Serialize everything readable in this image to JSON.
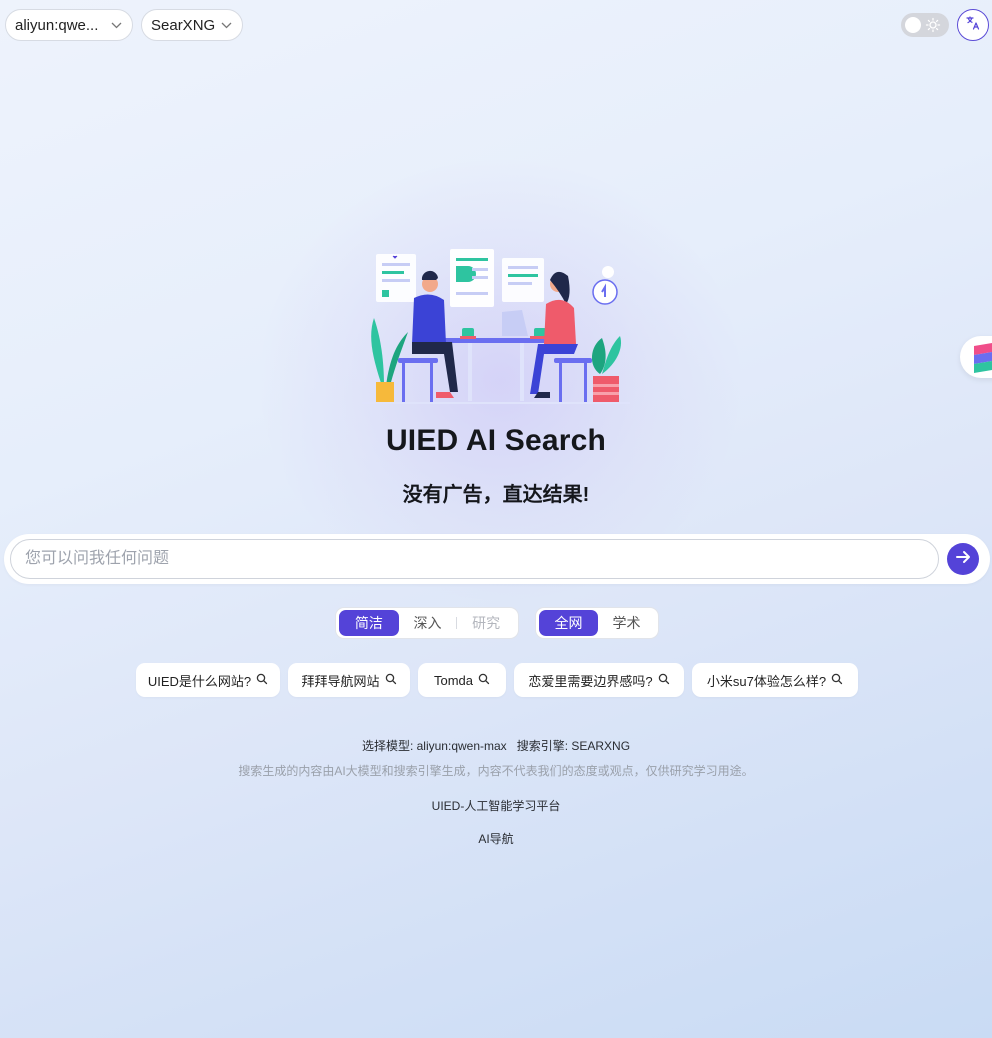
{
  "header": {
    "model_select": {
      "value": "aliyun:qwe...",
      "icon": "chevron-down-icon"
    },
    "engine_select": {
      "value": "SearXNG",
      "icon": "chevron-down-icon"
    },
    "theme_toggle": {
      "icon": "sun-icon",
      "state": "light"
    },
    "language_button": {
      "icon": "translate-icon"
    }
  },
  "hero": {
    "title": "UIED AI Search",
    "subtitle": "没有广告，直达结果!"
  },
  "search": {
    "placeholder": "您可以问我任何问题",
    "value": "",
    "send_icon": "arrow-right-icon"
  },
  "modes": [
    {
      "label": "简洁",
      "active": true
    },
    {
      "label": "深入",
      "active": false
    },
    {
      "label": "研究",
      "active": false,
      "disabled": true
    }
  ],
  "scopes": [
    {
      "label": "全网",
      "active": true
    },
    {
      "label": "学术",
      "active": false
    }
  ],
  "suggestions": [
    {
      "label": "UIED是什么网站?"
    },
    {
      "label": "拜拜导航网站"
    },
    {
      "label": "Tomda"
    },
    {
      "label": "恋爱里需要边界感吗?"
    },
    {
      "label": "小米su7体验怎么样?"
    }
  ],
  "footer": {
    "model_label": "选择模型:",
    "model_value": "aliyun:qwen-max",
    "engine_label": "搜索引擎:",
    "engine_value": "SEARXNG",
    "disclaimer": "搜索生成的内容由AI大模型和搜索引擎生成，内容不代表我们的态度或观点，仅供研究学习用途。",
    "links": [
      "UIED-人工智能学习平台",
      "AI导航"
    ]
  },
  "colors": {
    "accent": "#5443d8",
    "background_top": "#eef3fc",
    "background_bottom": "#c9dbf4"
  }
}
